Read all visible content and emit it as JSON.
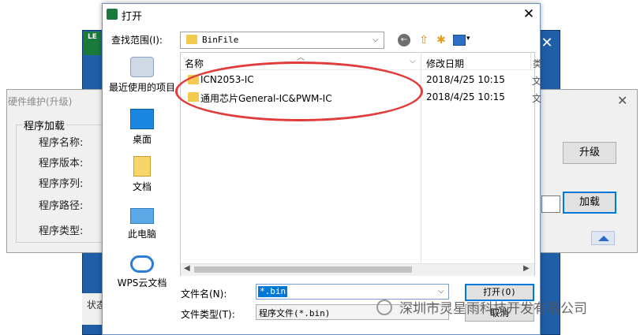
{
  "background_app": {
    "icon_text": "LE",
    "close_glyph": "✕",
    "status_fragment": "状态"
  },
  "firmware_window": {
    "title": "硬件维护(升级)",
    "close_glyph": "✕",
    "group_label": "程序加载",
    "fields": [
      "程序名称:",
      "程序版本:",
      "程序序列:",
      "程序路径:",
      "程序类型:"
    ],
    "upgrade_button": "升级",
    "load_button": "加载"
  },
  "dialog": {
    "title": "打开",
    "close_glyph": "✕",
    "look_in_label": "查找范围(I):",
    "look_in_value": "BinFile",
    "places": [
      {
        "label": "最近使用的项目",
        "icon": "recent-items-icon"
      },
      {
        "label": "桌面",
        "icon": "desktop-icon"
      },
      {
        "label": "文档",
        "icon": "documents-icon"
      },
      {
        "label": "此电脑",
        "icon": "this-pc-icon"
      },
      {
        "label": "WPS云文档",
        "icon": "wps-cloud-icon"
      }
    ],
    "columns": {
      "name": "名称",
      "date": "修改日期",
      "more": "类"
    },
    "files": [
      {
        "name": "ICN2053-IC",
        "date": "2018/4/25 10:15",
        "trunc": "文"
      },
      {
        "name": "通用芯片General-IC&PWM-IC",
        "date": "2018/4/25 10:15",
        "trunc": "文"
      }
    ],
    "file_name_label": "文件名(N):",
    "file_name_value": "*.bin",
    "file_type_label": "文件类型(T):",
    "file_type_value": "程序文件(*.bin)",
    "open_button": "打开(O)",
    "cancel_button": "取消"
  },
  "watermark": "深圳市灵星雨科技开发有限公司",
  "colors": {
    "accent": "#0078d7",
    "annotation": "#e23b3b",
    "folder": "#f3c94e"
  }
}
